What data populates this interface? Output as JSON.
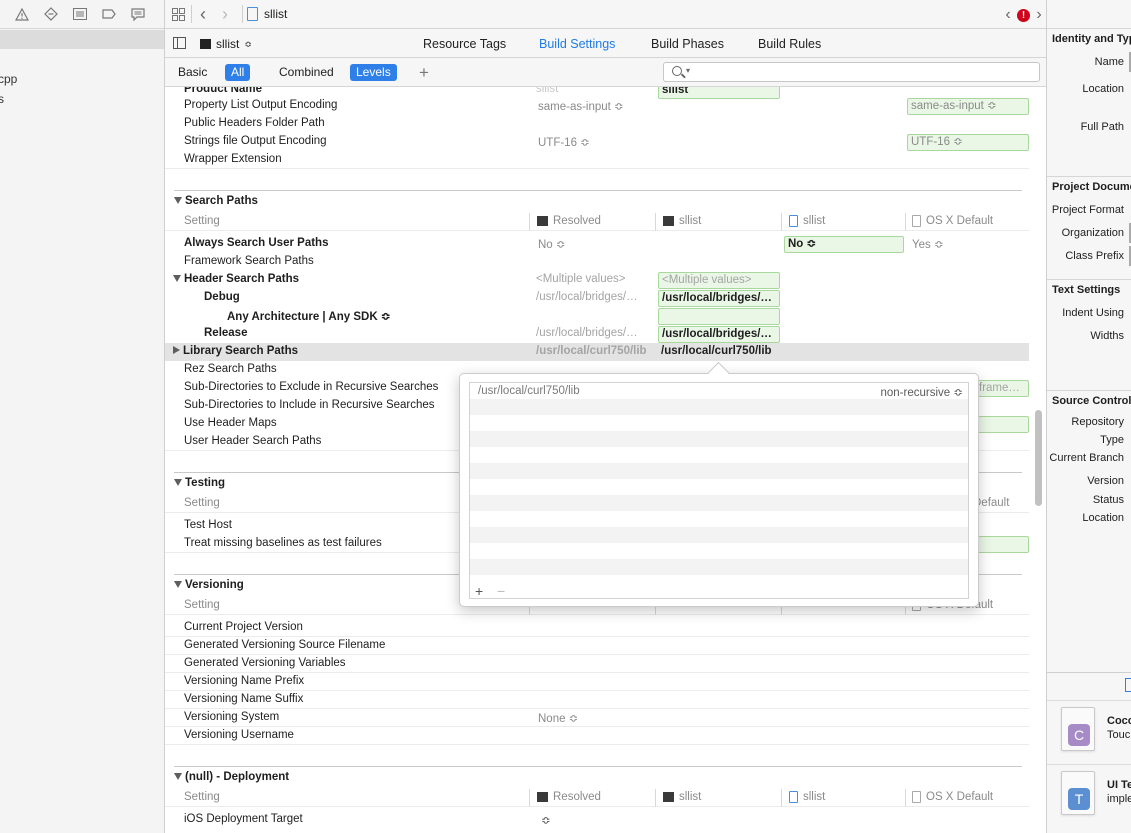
{
  "navigator": {
    "toolbar_icons": [
      "warning-icon",
      "breakpoint-icon",
      "list-icon",
      "tag-icon",
      "comment-icon"
    ],
    "files": [
      "cpp",
      "s"
    ]
  },
  "jumpbar": {
    "file_name": "sllist",
    "error_count": "!"
  },
  "tabbar": {
    "target": "sllist",
    "tabs": [
      "Resource Tags",
      "Build Settings",
      "Build Phases",
      "Build Rules"
    ],
    "active_tab": "Build Settings"
  },
  "filterbar": {
    "scope": [
      "Basic",
      "All",
      "Combined",
      "Levels"
    ],
    "search_placeholder": "",
    "search_scope": "Q▾"
  },
  "colhdr": {
    "setting": "Setting",
    "resolved": "Resolved",
    "target": "sllist",
    "project": "sllist",
    "default": "OS X Default"
  },
  "packaging": {
    "product_name": {
      "label": "Product Name",
      "resolved": "sllist",
      "target": "sllist"
    },
    "plist_encoding": {
      "label": "Property List Output Encoding",
      "resolved": "same-as-input ≎",
      "default": "same-as-input ≎"
    },
    "public_headers": {
      "label": "Public Headers Folder Path"
    },
    "strings_encoding": {
      "label": "Strings file Output Encoding",
      "resolved": "UTF-16 ≎",
      "default": "UTF-16 ≎"
    },
    "wrapper_ext": {
      "label": "Wrapper Extension"
    }
  },
  "search_paths": {
    "title": "Search Paths",
    "always_search": {
      "label": "Always Search User Paths",
      "resolved": "No ≎",
      "project": "No ≎",
      "default": "Yes ≎"
    },
    "framework": {
      "label": "Framework Search Paths",
      "default_trunc": "frame…"
    },
    "header": {
      "label": "Header Search Paths",
      "resolved": "<Multiple values>",
      "target": "<Multiple values>"
    },
    "debug": {
      "label": "Debug",
      "resolved": "/usr/local/bridges/…",
      "target": "/usr/local/bridges/…"
    },
    "any_arch": {
      "label": "Any Architecture | Any SDK ≎"
    },
    "release": {
      "label": "Release",
      "resolved": "/usr/local/bridges/…",
      "target": "/usr/local/bridges/…"
    },
    "library": {
      "label": "Library Search Paths",
      "resolved": "/usr/local/curl750/lib",
      "target": "/usr/local/curl750/lib"
    },
    "rez": {
      "label": "Rez Search Paths"
    },
    "sub_exclude": {
      "label": "Sub-Directories to Exclude in Recursive Searches"
    },
    "sub_include": {
      "label": "Sub-Directories to Include in Recursive Searches"
    },
    "header_maps": {
      "label": "Use Header Maps"
    },
    "user_header": {
      "label": "User Header Search Paths"
    }
  },
  "testing": {
    "title": "Testing",
    "test_host": {
      "label": "Test Host"
    },
    "treat_missing": {
      "label": "Treat missing baselines as test failures"
    },
    "default_trunc": "Default"
  },
  "versioning": {
    "title": "Versioning",
    "items": [
      "Current Project Version",
      "Generated Versioning Source Filename",
      "Generated Versioning Variables",
      "Versioning Name Prefix",
      "Versioning Name Suffix",
      "Versioning System",
      "Versioning Username"
    ],
    "system_value": "None ≎"
  },
  "deployment": {
    "title": "(null) - Deployment",
    "ios_target": {
      "label": "iOS Deployment Target",
      "resolved": "≎"
    }
  },
  "popover": {
    "path": "/usr/local/curl750/lib",
    "mode": "non-recursive ≎",
    "add": "+",
    "remove": "−"
  },
  "inspector": {
    "identity_title": "Identity and Type",
    "name_label": "Name",
    "location_label": "Location",
    "full_path_label": "Full Path",
    "project_doc_title": "Project Document",
    "project_format_label": "Project Format",
    "organization_label": "Organization",
    "class_prefix_label": "Class Prefix",
    "text_settings_title": "Text Settings",
    "indent_using_label": "Indent Using",
    "widths_label": "Widths",
    "source_control_title": "Source Control",
    "repository_label": "Repository",
    "type_label": "Type",
    "current_branch_label": "Current Branch",
    "version_label": "Version",
    "status_label": "Status",
    "sc_location_label": "Location",
    "lib1_title": "Cocoa",
    "lib1_sub": "Touch",
    "lib1_badge": "C",
    "lib2_title": "UI Te",
    "lib2_sub": "imple",
    "lib2_badge": "T"
  },
  "colors": {
    "accent": "#2e7fe8",
    "green_fill": "#eaf7e6",
    "green_border": "#a9d89d",
    "error": "#d0021b",
    "cocoa_badge": "#a78bc6",
    "ui_test_badge": "#5b8fd1"
  }
}
